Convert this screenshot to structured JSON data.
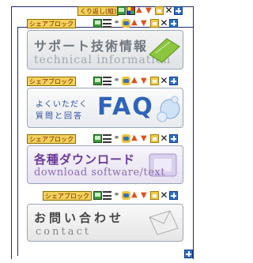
{
  "header": {
    "no_wrap_button": "くり返し(縦)"
  },
  "share_block_label": "シェアブロック",
  "toolbar_icons": [
    "monitor-icon",
    "lines-icon",
    "people-icon",
    "person-icon",
    "arrow-up-icon",
    "arrow-down-icon",
    "folder-icon",
    "close-icon",
    "plus-icon"
  ],
  "banners": [
    {
      "title": "サポート技術情報",
      "subtitle": "technical information"
    },
    {
      "line1": "よくいただく",
      "line2": "質問と回答",
      "big": "FAQ"
    },
    {
      "title": "各種ダウンロード",
      "subtitle": "download software/text"
    },
    {
      "title": "お問い合わせ",
      "subtitle": "contact"
    }
  ],
  "colors": {
    "frame": "#1f2a6b",
    "tag_bg": "#f2d25a"
  }
}
